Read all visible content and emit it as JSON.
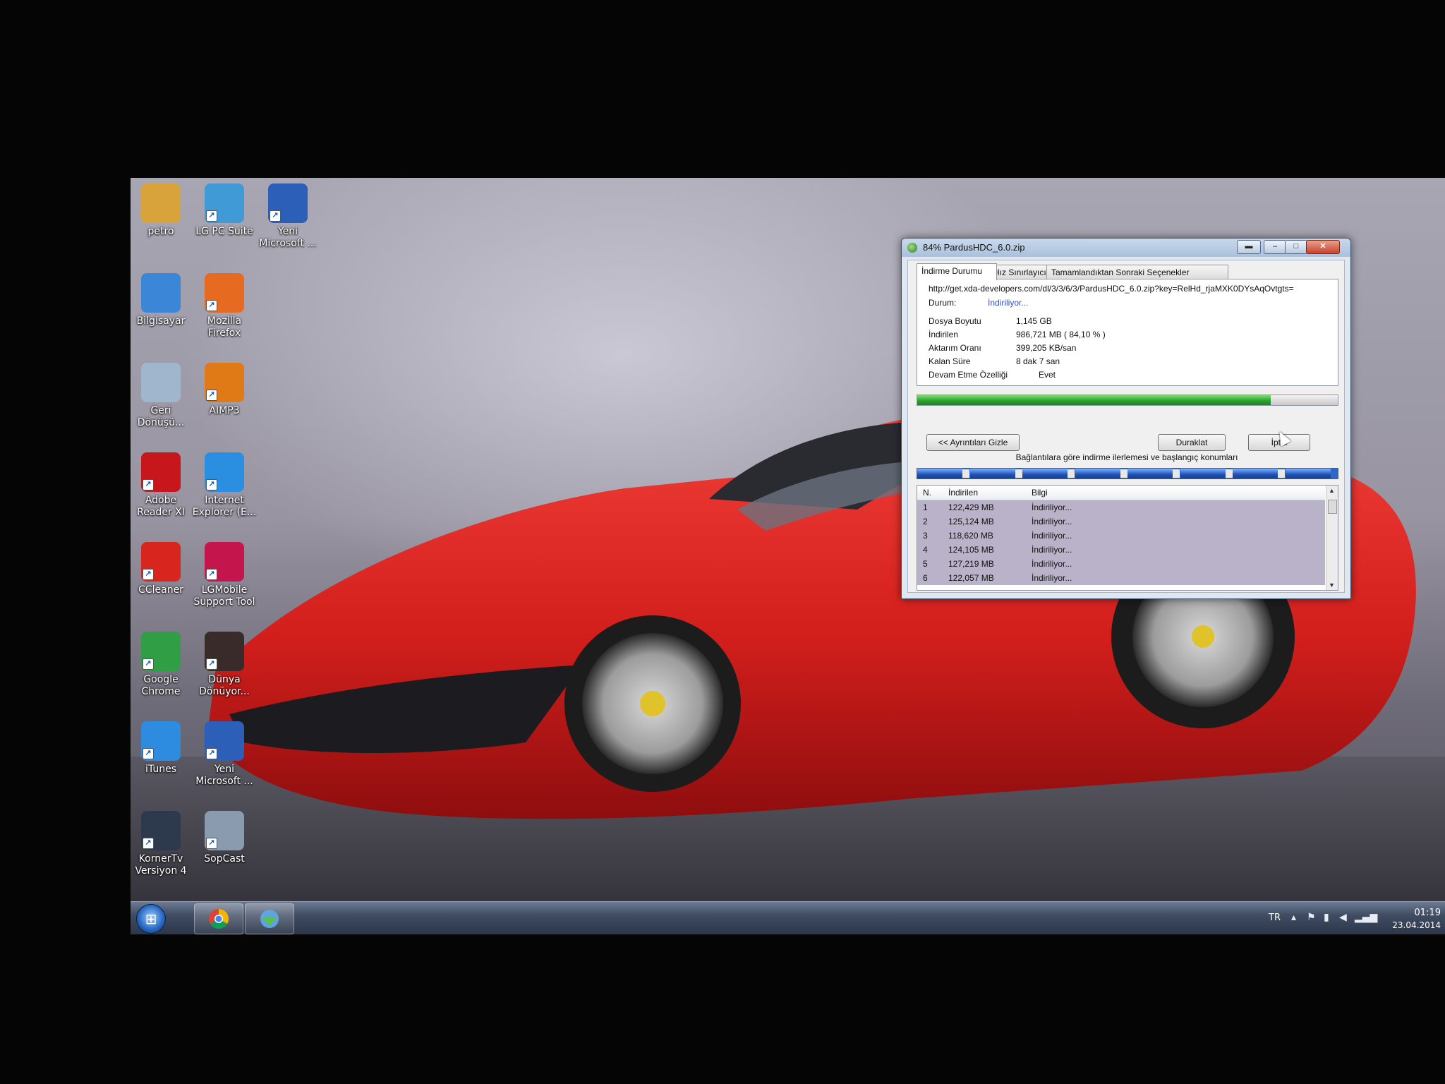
{
  "desktop_icons": [
    {
      "label": "petro",
      "icon": "user-folder-icon",
      "color": "#d8a33a"
    },
    {
      "label": "LG PC Suite",
      "icon": "lg-pc-suite-icon",
      "color": "#3f9ad6"
    },
    {
      "label": "Yeni Microsoft ...",
      "icon": "word-document-icon",
      "color": "#2b5fb8"
    },
    {
      "label": "Bilgisayar",
      "icon": "computer-icon",
      "color": "#3b86d6"
    },
    {
      "label": "Mozilla Firefox",
      "icon": "firefox-icon",
      "color": "#e66a1f"
    },
    {
      "label": "Geri Dönüşü...",
      "icon": "recycle-bin-icon",
      "color": "#9fb6cc"
    },
    {
      "label": "AIMP3",
      "icon": "aimp3-icon",
      "color": "#e07a16"
    },
    {
      "label": "Adobe Reader XI",
      "icon": "adobe-reader-icon",
      "color": "#c8161d"
    },
    {
      "label": "Internet Explorer (E...",
      "icon": "internet-explorer-icon",
      "color": "#2a8fe0"
    },
    {
      "label": "CCleaner",
      "icon": "ccleaner-icon",
      "color": "#d8261f"
    },
    {
      "label": "LGMobile Support Tool",
      "icon": "lg-mobile-icon",
      "color": "#c4154c"
    },
    {
      "label": "Google Chrome",
      "icon": "chrome-icon",
      "color": "#2f9e44"
    },
    {
      "label": "Dünya Dönüyor...",
      "icon": "mp3-icon",
      "color": "#3a2b2b"
    },
    {
      "label": "iTunes",
      "icon": "itunes-icon",
      "color": "#2d8be0"
    },
    {
      "label": "Yeni Microsoft ...",
      "icon": "word-document-icon",
      "color": "#2b5fb8"
    },
    {
      "label": "KornerTv Versiyon 4",
      "icon": "kornertv-icon",
      "color": "#2d3a4d"
    },
    {
      "label": "SopCast",
      "icon": "sopcast-icon",
      "color": "#8a9bb0"
    }
  ],
  "window": {
    "title": "84% PardusHDC_6.0.zip",
    "tabs": [
      "İndirme Durumu",
      "Hız Sınırlayıcı",
      "Tamamlandıktan Sonraki Seçenekler"
    ],
    "active_tab": 0,
    "url": "http://get.xda-developers.com/dl/3/3/6/3/PardusHDC_6.0.zip?key=RelHd_rjaMXK0DYsAqOvtgts=",
    "status_label": "Durum:",
    "status_value": "İndiriliyor...",
    "fields": [
      {
        "label": "Dosya Boyutu",
        "value": "1,145  GB"
      },
      {
        "label": "İndirilen",
        "value": "986,721  MB  ( 84,10 % )"
      },
      {
        "label": "Aktarım Oranı",
        "value": "399,205  KB/san"
      },
      {
        "label": "Kalan Süre",
        "value": "8 dak 7 san"
      },
      {
        "label": "Devam Etme Özelliği",
        "value": "Evet"
      }
    ],
    "progress_fraction": 0.841,
    "buttons": {
      "hide_details": "<< Ayrıntıları Gizle",
      "pause": "Duraklat",
      "cancel": "İptal"
    },
    "connections_caption": "Bağlantılara göre indirme ilerlemesi ve başlangıç konumları",
    "segments_count": 8,
    "table": {
      "columns": [
        "N.",
        "İndirilen",
        "Bilgi"
      ],
      "rows": [
        [
          "1",
          "122,429  MB",
          "İndiriliyor..."
        ],
        [
          "2",
          "125,124  MB",
          "İndiriliyor..."
        ],
        [
          "3",
          "118,620  MB",
          "İndiriliyor..."
        ],
        [
          "4",
          "124,105  MB",
          "İndiriliyor..."
        ],
        [
          "5",
          "127,219  MB",
          "İndiriliyor..."
        ],
        [
          "6",
          "122,057  MB",
          "İndiriliyor..."
        ]
      ]
    }
  },
  "taskbar": {
    "language": "TR",
    "time": "01:19",
    "date": "23.04.2014"
  }
}
